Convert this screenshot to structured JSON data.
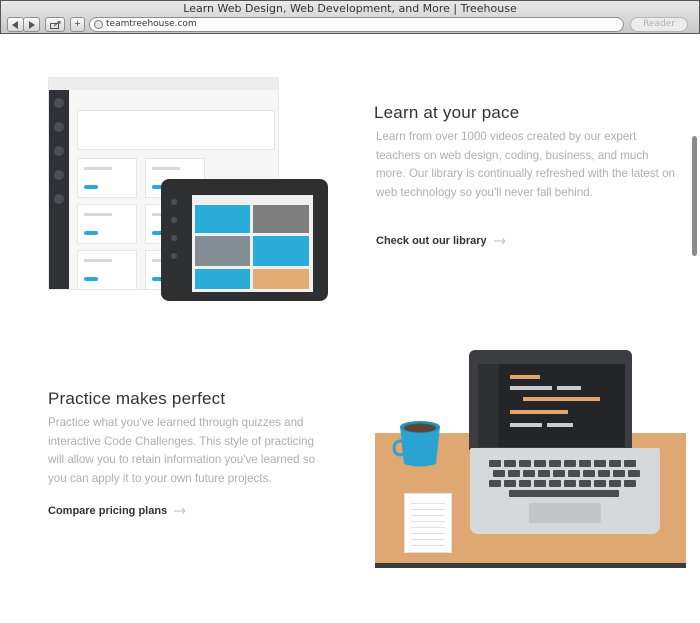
{
  "browser": {
    "window_title": "Learn Web Design, Web Development, and More | Treehouse",
    "url": "teamtreehouse.com",
    "reader_label": "Reader",
    "add_tab_label": "+"
  },
  "sections": [
    {
      "heading": "Learn at your pace",
      "body": "Learn from over 1000 videos created by our expert teachers on web design, coding, business, and much more. Our library is continually refreshed with the latest on web technology so you'll never fall behind.",
      "link": "Check out our library"
    },
    {
      "heading": "Practice makes perfect",
      "body": "Practice what you've learned through quizzes and interactive Code Challenges. This style of practicing will allow you to retain information you've learned so you can apply it to your own future projects.",
      "link": "Compare pricing plans"
    }
  ],
  "colors": {
    "accent_blue": "#28a9d7",
    "desk": "#dfa873",
    "code_orange": "#e4a56c",
    "dark": "#2f3338"
  },
  "icons": [
    "back-icon",
    "forward-icon",
    "share-icon",
    "globe-icon",
    "arrow-right-icon"
  ]
}
